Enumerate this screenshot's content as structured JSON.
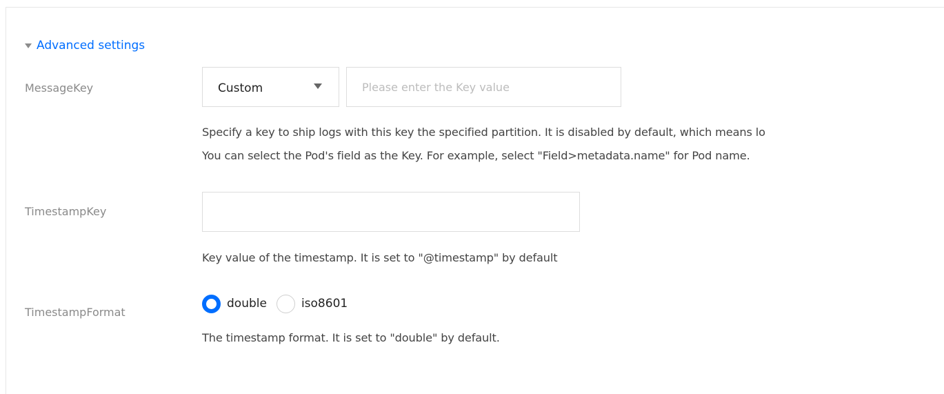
{
  "advanced_settings": {
    "toggle_label": "Advanced settings"
  },
  "message_key": {
    "label": "MessageKey",
    "select_value": "Custom",
    "input_value": "",
    "input_placeholder": "Please enter the Key value",
    "help_line1": "Specify a key to ship logs with this key the specified partition. It is disabled by default, which means lo",
    "help_line2": "You can select the Pod's field as the Key. For example, select \"Field>metadata.name\" for Pod name."
  },
  "timestamp_key": {
    "label": "TimestampKey",
    "input_value": "",
    "help": "Key value of the timestamp. It is set to \"@timestamp\" by default"
  },
  "timestamp_format": {
    "label": "TimestampFormat",
    "options": [
      {
        "label": "double",
        "checked": true
      },
      {
        "label": "iso8601",
        "checked": false
      }
    ],
    "help": "The timestamp format. It is set to \"double\" by default."
  },
  "colors": {
    "accent": "#006eff",
    "label_text": "#8a8a8a",
    "help_text": "#444444",
    "border": "#dddddd"
  }
}
